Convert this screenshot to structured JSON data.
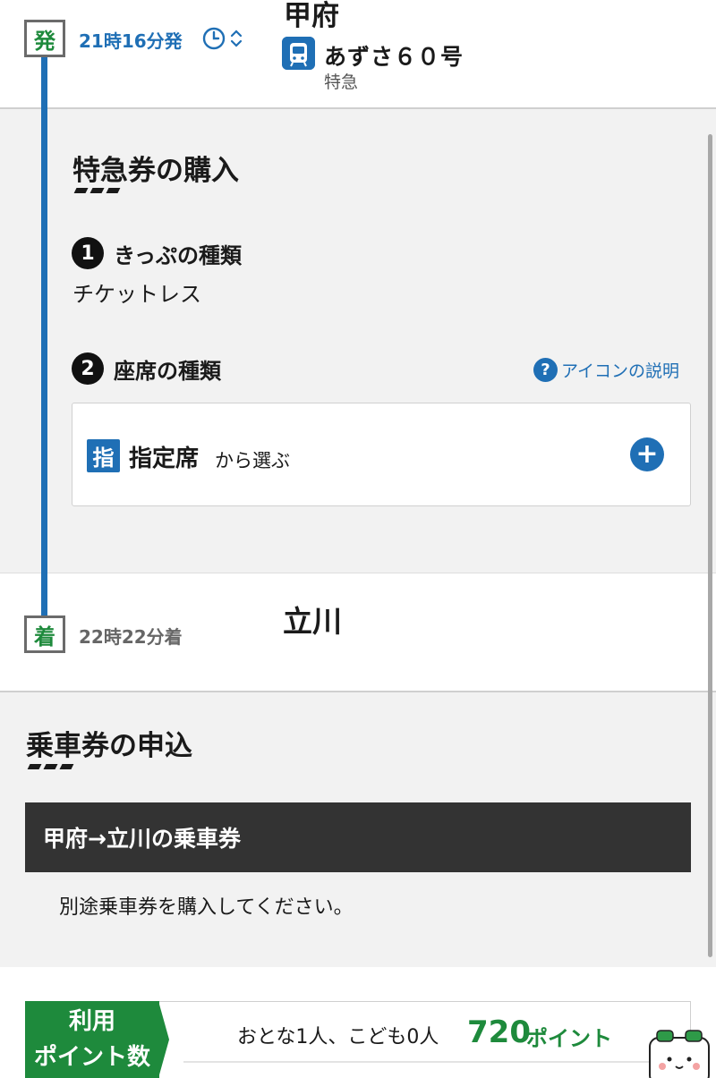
{
  "departure": {
    "badge": "発",
    "time": "21時16分発",
    "station": "甲府",
    "train_name": "あずさ６０号",
    "train_type": "特急"
  },
  "express_ticket": {
    "heading": "特急券の購入",
    "step1": {
      "number": "1",
      "label": "きっぷの種類",
      "value": "チケットレス"
    },
    "step2": {
      "number": "2",
      "label": "座席の種類"
    },
    "help_link": "アイコンの説明",
    "seat_option": {
      "badge": "指",
      "name": "指定席",
      "suffix": "から選ぶ",
      "add_symbol": "+"
    }
  },
  "arrival": {
    "badge": "着",
    "time": "22時22分着",
    "station": "立川"
  },
  "fare_ticket": {
    "heading": "乗車券の申込",
    "bar_title": "甲府→立川の乗車券",
    "note": "別途乗車券を購入してください。"
  },
  "points": {
    "label_line1": "利用",
    "label_line2": "ポイント数",
    "people": "おとな1人、こども0人",
    "value": "720",
    "unit": "ポイント"
  },
  "icons": {
    "help": "question-icon",
    "clock": "clock-icon",
    "train": "train-icon",
    "add": "plus-icon"
  },
  "colors": {
    "accent_blue": "#1f6fb5",
    "accent_green": "#1e8a3c",
    "dark_bar": "#333333"
  }
}
